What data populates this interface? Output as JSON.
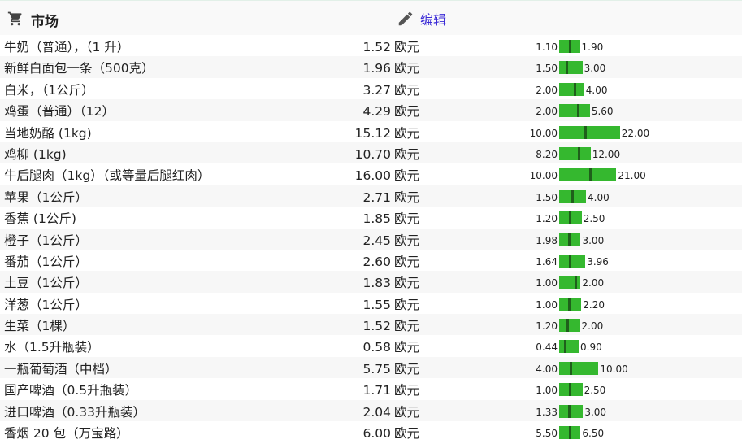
{
  "header": {
    "title": "市场",
    "edit_label": "编辑",
    "cart_icon": "shopping-cart-icon",
    "edit_icon": "pencil-icon"
  },
  "colors": {
    "bar": "#35b82f",
    "marker": "#1f5f1b",
    "link": "#3a2ad6"
  },
  "currency": "欧元",
  "items": [
    {
      "name": "牛奶（普通），（1 升）",
      "price": "1.52",
      "min": "1.10",
      "max": "1.90"
    },
    {
      "name": "新鲜白面包一条（500克）",
      "price": "1.96",
      "min": "1.50",
      "max": "3.00"
    },
    {
      "name": "白米，（1公斤）",
      "price": "3.27",
      "min": "2.00",
      "max": "4.00"
    },
    {
      "name": "鸡蛋（普通）（12）",
      "price": "4.29",
      "min": "2.00",
      "max": "5.60"
    },
    {
      "name": "当地奶酪 (1kg)",
      "price": "15.12",
      "min": "10.00",
      "max": "22.00"
    },
    {
      "name": "鸡柳 (1kg)",
      "price": "10.70",
      "min": "8.20",
      "max": "12.00"
    },
    {
      "name": "牛后腿肉（1kg）（或等量后腿红肉）",
      "price": "16.00",
      "min": "10.00",
      "max": "21.00"
    },
    {
      "name": "苹果（1公斤）",
      "price": "2.71",
      "min": "1.50",
      "max": "4.00"
    },
    {
      "name": "香蕉 (1公斤)",
      "price": "1.85",
      "min": "1.20",
      "max": "2.50"
    },
    {
      "name": "橙子（1公斤）",
      "price": "2.45",
      "min": "1.98",
      "max": "3.00"
    },
    {
      "name": "番茄（1公斤）",
      "price": "2.60",
      "min": "1.64",
      "max": "3.96"
    },
    {
      "name": "土豆（1公斤）",
      "price": "1.83",
      "min": "1.00",
      "max": "2.00"
    },
    {
      "name": "洋葱（1公斤）",
      "price": "1.55",
      "min": "1.00",
      "max": "2.20"
    },
    {
      "name": "生菜（1棵）",
      "price": "1.52",
      "min": "1.20",
      "max": "2.00"
    },
    {
      "name": "水（1.5升瓶装）",
      "price": "0.58",
      "min": "0.44",
      "max": "0.90"
    },
    {
      "name": "一瓶葡萄酒（中档）",
      "price": "5.75",
      "min": "4.00",
      "max": "10.00"
    },
    {
      "name": "国产啤酒（0.5升瓶装）",
      "price": "1.71",
      "min": "1.00",
      "max": "2.50"
    },
    {
      "name": "进口啤酒（0.33升瓶装）",
      "price": "2.04",
      "min": "1.33",
      "max": "3.00"
    },
    {
      "name": "香烟 20 包（万宝路）",
      "price": "6.00",
      "min": "5.50",
      "max": "6.50"
    }
  ]
}
